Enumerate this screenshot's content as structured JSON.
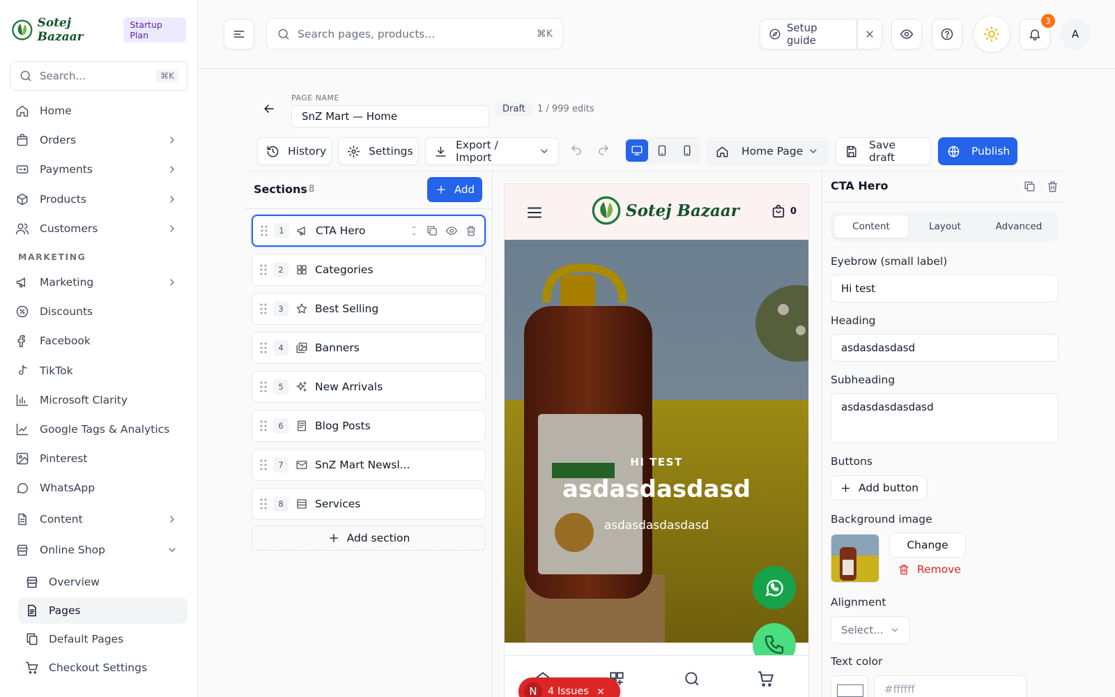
{
  "brand": {
    "name": "Sotej Bazaar",
    "plan": "Startup Plan",
    "accent": "#2563eb",
    "brand_green": "#14532d"
  },
  "sidebar": {
    "search_placeholder": "Search...",
    "search_kbd": "⌘K",
    "items": [
      {
        "label": "Home",
        "icon": "home-icon"
      },
      {
        "label": "Orders",
        "icon": "bag-icon",
        "expandable": true
      },
      {
        "label": "Payments",
        "icon": "credit-card-icon",
        "expandable": true
      },
      {
        "label": "Products",
        "icon": "box-icon",
        "expandable": true
      },
      {
        "label": "Customers",
        "icon": "users-icon",
        "expandable": true
      }
    ],
    "marketing_heading": "MARKETING",
    "marketing_items": [
      {
        "label": "Marketing",
        "icon": "megaphone-icon",
        "expandable": true
      },
      {
        "label": "Discounts",
        "icon": "discount-icon"
      },
      {
        "label": "Facebook",
        "icon": "facebook-icon"
      },
      {
        "label": "TikTok",
        "icon": "tiktok-icon"
      },
      {
        "label": "Microsoft Clarity",
        "icon": "bar-chart-icon"
      },
      {
        "label": "Google Tags & Analytics",
        "icon": "line-chart-icon"
      },
      {
        "label": "Pinterest",
        "icon": "image-icon"
      },
      {
        "label": "WhatsApp",
        "icon": "chat-icon"
      },
      {
        "label": "Content",
        "icon": "document-icon",
        "expandable": true
      },
      {
        "label": "Online Shop",
        "icon": "store-icon",
        "expanded": true
      }
    ],
    "shop_items": [
      {
        "label": "Overview",
        "icon": "store-icon",
        "active": false
      },
      {
        "label": "Pages",
        "icon": "pages-icon",
        "active": true
      },
      {
        "label": "Default Pages",
        "icon": "copy-icon",
        "active": false
      },
      {
        "label": "Checkout Settings",
        "icon": "cart-icon",
        "active": false
      }
    ]
  },
  "topbar": {
    "search_placeholder": "Search pages, products...",
    "search_kbd": "⌘K",
    "setup_guide": "Setup guide",
    "notifications_count": "3",
    "avatar_initial": "A"
  },
  "editor": {
    "page_name_label": "PAGE NAME",
    "page_name": "SnZ Mart — Home",
    "status": "Draft",
    "edits": "1 / 999 edits",
    "toolbar": {
      "history": "History",
      "settings": "Settings",
      "export_import": "Export / Import",
      "page_select": "Home Page",
      "save_draft": "Save draft",
      "publish": "Publish"
    }
  },
  "sections_panel": {
    "title": "Sections",
    "count": "8",
    "add_label": "Add",
    "add_section_label": "Add section",
    "sections": [
      {
        "num": "1",
        "label": "CTA Hero",
        "icon": "megaphone-icon",
        "selected": true
      },
      {
        "num": "2",
        "label": "Categories",
        "icon": "grid-icon"
      },
      {
        "num": "3",
        "label": "Best Selling",
        "icon": "star-icon"
      },
      {
        "num": "4",
        "label": "Banners",
        "icon": "images-icon"
      },
      {
        "num": "5",
        "label": "New Arrivals",
        "icon": "sparkles-icon"
      },
      {
        "num": "6",
        "label": "Blog Posts",
        "icon": "newspaper-icon"
      },
      {
        "num": "7",
        "label": "SnZ Mart Newsl...",
        "icon": "mail-icon"
      },
      {
        "num": "8",
        "label": "Services",
        "icon": "list-icon"
      }
    ]
  },
  "preview": {
    "cart_count": "0",
    "logo_text": "Sotej Bazaar",
    "hero_eyebrow": "HI TEST",
    "hero_heading": "asdasdasdasd",
    "hero_subheading": "asdasdasdasdasd",
    "issues_initial": "N",
    "issues_label": "4 Issues"
  },
  "properties": {
    "title": "CTA Hero",
    "tabs": [
      "Content",
      "Layout",
      "Advanced"
    ],
    "active_tab": "Content",
    "eyebrow_label": "Eyebrow (small label)",
    "eyebrow_value": "Hi test",
    "heading_label": "Heading",
    "heading_value": "asdasdasdasd",
    "subheading_label": "Subheading",
    "subheading_value": "asdasdasdasdasd",
    "buttons_label": "Buttons",
    "add_button": "Add button",
    "bg_label": "Background image",
    "change": "Change",
    "remove": "Remove",
    "alignment_label": "Alignment",
    "alignment_placeholder": "Select...",
    "text_color_label": "Text color",
    "text_color_value": "#ffffff"
  }
}
